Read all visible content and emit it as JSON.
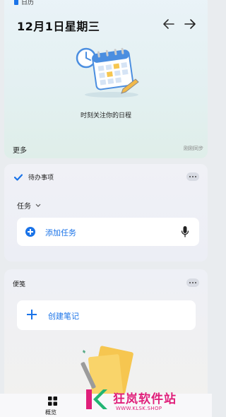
{
  "calendar": {
    "app_name": "日历",
    "date_title": "12月1日星期三",
    "subtitle": "时刻关注你的日程",
    "more_label": "更多",
    "sync_label": "刚刚同步"
  },
  "todo": {
    "title": "待办事项",
    "filter_label": "任务",
    "add_label": "添加任务"
  },
  "notes": {
    "title": "便笺",
    "create_label": "创建笔记"
  },
  "bottom_nav": {
    "items": [
      {
        "label": "概览",
        "icon": "overview-grid-icon"
      }
    ]
  },
  "watermark": {
    "text": "狂岚软件站",
    "url": "WWW.KLSK.SHOP"
  },
  "colors": {
    "accent": "#1a73e8",
    "watermark": "#e01f7a"
  }
}
